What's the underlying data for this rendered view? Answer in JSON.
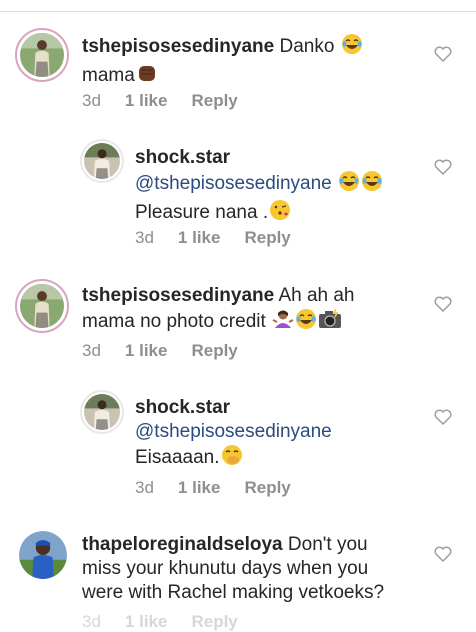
{
  "comments": [
    {
      "username": "tshepisosesedinyane",
      "text_a": "Danko",
      "text_b": "mama",
      "emojis": [
        "face-with-tears-of-joy",
        "raised-fist-dark-skin"
      ],
      "time": "3d",
      "likes": "1 like",
      "reply": "Reply"
    },
    {
      "username": "shock.star",
      "mention": "@tshepisosesedinyane",
      "text": "Pleasure nana .",
      "emojis": [
        "face-with-tears-of-joy",
        "face-with-tears-of-joy",
        "face-blowing-a-kiss"
      ],
      "time": "3d",
      "likes": "1 like",
      "reply": "Reply"
    },
    {
      "username": "tshepisosesedinyane",
      "text_a": "Ah ah ah",
      "text_b": "mama no photo credit",
      "emojis": [
        "person-shrugging",
        "face-with-tears-of-joy",
        "camera-with-flash"
      ],
      "time": "3d",
      "likes": "1 like",
      "reply": "Reply"
    },
    {
      "username": "shock.star",
      "mention": "@tshepisosesedinyane",
      "text": "Eisaaaan.",
      "emojis": [
        "face-with-hand-over-mouth"
      ],
      "time": "3d",
      "likes": "1 like",
      "reply": "Reply"
    },
    {
      "username": "thapeloreginaldseloya",
      "text_a": "Don't you",
      "text_b": "miss your khunutu days when you",
      "text_c": "were with Rachel  making vetkoeks?",
      "time": "3d",
      "likes": "1 like",
      "reply": "Reply"
    }
  ],
  "colors": {
    "username": "#262626",
    "mention": "#2b4b7e",
    "meta": "#8e8e8e",
    "heart": "#9e9e9e",
    "story_ring": "#d9a3c2"
  }
}
